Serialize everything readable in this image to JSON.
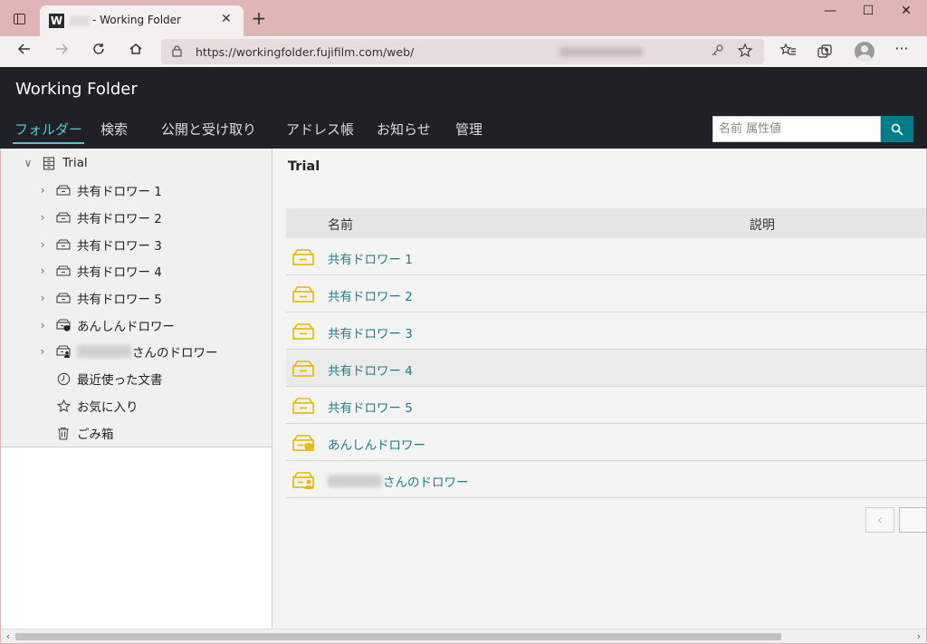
{
  "browser": {
    "tab_icon_letter": "W",
    "tab_title": "- Working Folder",
    "tab_close": "✕",
    "new_tab": "+",
    "url": "https://workingfolder.fujifilm.com/web/",
    "window_controls": {
      "minimize": "—",
      "maximize": "☐",
      "close": "✕"
    }
  },
  "app": {
    "title": "Working Folder",
    "nav_tabs": [
      {
        "label": "フォルダー",
        "active": true
      },
      {
        "label": "検索",
        "active": false
      },
      {
        "label": "公開と受け取り",
        "active": false
      },
      {
        "label": "アドレス帳",
        "active": false
      },
      {
        "label": "お知らせ",
        "active": false
      },
      {
        "label": "管理",
        "active": false
      }
    ],
    "search_placeholder": "名前 属性値"
  },
  "tree": {
    "root": {
      "label": "Trial",
      "icon": "cabinet-icon"
    },
    "items": [
      {
        "label": "共有ドロワー 1",
        "icon": "drawer-icon"
      },
      {
        "label": "共有ドロワー 2",
        "icon": "drawer-icon"
      },
      {
        "label": "共有ドロワー 3",
        "icon": "drawer-icon"
      },
      {
        "label": "共有ドロワー 4",
        "icon": "drawer-icon"
      },
      {
        "label": "共有ドロワー 5",
        "icon": "drawer-icon"
      },
      {
        "label": "あんしんドロワー",
        "icon": "secure-drawer-icon"
      },
      {
        "label": "さんのドロワー",
        "icon": "personal-drawer-icon"
      }
    ],
    "extras": [
      {
        "label": "最近使った文書",
        "icon": "clock-icon"
      },
      {
        "label": "お気に入り",
        "icon": "star-icon"
      },
      {
        "label": "ごみ箱",
        "icon": "trash-icon"
      }
    ]
  },
  "content": {
    "title": "Trial",
    "columns": {
      "name": "名前",
      "description": "説明"
    },
    "rows": [
      {
        "name": "共有ドロワー 1",
        "description": ""
      },
      {
        "name": "共有ドロワー 2",
        "description": ""
      },
      {
        "name": "共有ドロワー 3",
        "description": ""
      },
      {
        "name": "共有ドロワー 4",
        "description": ""
      },
      {
        "name": "共有ドロワー 5",
        "description": ""
      },
      {
        "name": "あんしんドロワー",
        "description": ""
      },
      {
        "name": "さんのドロワー",
        "description": ""
      }
    ],
    "pager_prev": "‹"
  },
  "colors": {
    "accent": "#5bc3d2",
    "link": "#187f86",
    "search_button": "#007d8a",
    "drawer_icon": "#e6b800",
    "header_bg": "#1f2126",
    "chrome_bg": "#dfb5b5"
  }
}
